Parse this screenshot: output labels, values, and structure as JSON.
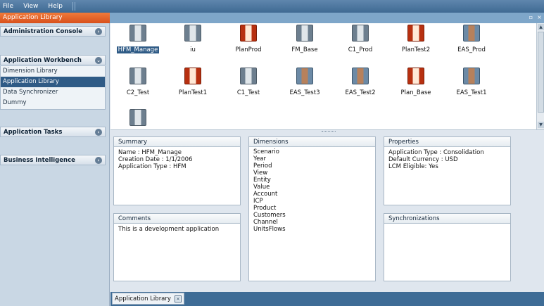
{
  "menu": {
    "items": [
      "File",
      "View",
      "Help"
    ]
  },
  "window": {
    "title": "Application Library"
  },
  "sidebar": {
    "admin_console": "Administration Console",
    "workbench": {
      "title": "Application Workbench",
      "items": [
        "Dimension Library",
        "Application Library",
        "Data Synchronizer",
        "Dummy"
      ],
      "selected": "Application Library"
    },
    "app_tasks": "Application Tasks",
    "business_intelligence": "Business Intelligence"
  },
  "applications": [
    {
      "name": "HFM_Manage",
      "icon": "hfm-app-icon",
      "selected": true
    },
    {
      "name": "iu",
      "icon": "hfm-app-icon"
    },
    {
      "name": "PlanProd",
      "icon": "planning-app-icon"
    },
    {
      "name": "FM_Base",
      "icon": "hfm-app-icon"
    },
    {
      "name": "C1_Prod",
      "icon": "hfm-app-icon"
    },
    {
      "name": "PlanTest2",
      "icon": "planning-app-icon"
    },
    {
      "name": "EAS_Prod",
      "icon": "essbase-app-icon"
    },
    {
      "name": "C2_Test",
      "icon": "hfm-app-icon"
    },
    {
      "name": "PlanTest1",
      "icon": "planning-app-icon"
    },
    {
      "name": "C1_Test",
      "icon": "hfm-app-icon"
    },
    {
      "name": "EAS_Test3",
      "icon": "essbase-app-icon"
    },
    {
      "name": "EAS_Test2",
      "icon": "essbase-app-icon"
    },
    {
      "name": "Plan_Base",
      "icon": "planning-app-icon"
    },
    {
      "name": "EAS_Test1",
      "icon": "essbase-app-icon"
    },
    {
      "name": "",
      "icon": "hfm-app-icon"
    }
  ],
  "summary": {
    "title": "Summary",
    "lines": [
      "Name : HFM_Manage",
      "Creation Date : 1/1/2006",
      "Application Type : HFM"
    ]
  },
  "dimensions": {
    "title": "Dimensions",
    "items": [
      "Scenario",
      "Year",
      "Period",
      "View",
      "Entity",
      "Value",
      "Account",
      "ICP",
      "Product",
      "Customers",
      "Channel",
      "UnitsFlows"
    ]
  },
  "properties": {
    "title": "Properties",
    "lines": [
      "Application Type : Consolidation",
      "Default Currency : USD",
      "LCM Eligible: Yes"
    ]
  },
  "comments": {
    "title": "Comments",
    "text": "This is a development application"
  },
  "synchronizations": {
    "title": "Synchronizations"
  },
  "bottom_tab": {
    "label": "Application Library"
  }
}
